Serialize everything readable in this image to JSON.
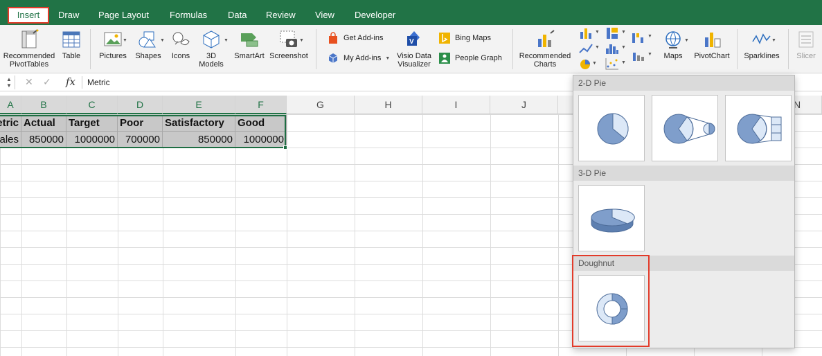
{
  "tabs": [
    {
      "label": "Insert",
      "active": true
    },
    {
      "label": "Draw"
    },
    {
      "label": "Page Layout"
    },
    {
      "label": "Formulas"
    },
    {
      "label": "Data"
    },
    {
      "label": "Review"
    },
    {
      "label": "View"
    },
    {
      "label": "Developer"
    }
  ],
  "ribbon": {
    "recommended_pivot": "Recommended PivotTables",
    "recommended_pivot_line1": "Recommended",
    "recommended_pivot_line2": "PivotTables",
    "table": "Table",
    "pictures": "Pictures",
    "shapes": "Shapes",
    "icons": "Icons",
    "models_3d_line1": "3D",
    "models_3d_line2": "Models",
    "smartart": "SmartArt",
    "screenshot": "Screenshot",
    "get_addins": "Get Add-ins",
    "my_addins": "My Add-ins",
    "visio_line1": "Visio Data",
    "visio_line2": "Visualizer",
    "bing_maps": "Bing Maps",
    "people_graph": "People Graph",
    "recommended_charts_line1": "Recommended",
    "recommended_charts_line2": "Charts",
    "maps": "Maps",
    "pivotchart": "PivotChart",
    "sparklines": "Sparklines",
    "slicer": "Slicer"
  },
  "formula_bar": {
    "content": "Metric"
  },
  "columns": [
    "A",
    "B",
    "C",
    "D",
    "E",
    "F",
    "G",
    "H",
    "I",
    "J",
    "N"
  ],
  "sheet": {
    "header_row": [
      "Metric",
      "Actual",
      "Target",
      "Poor",
      "Satisfactory",
      "Good"
    ],
    "data_row": [
      "Sales",
      "850000",
      "1000000",
      "700000",
      "850000",
      "1000000"
    ]
  },
  "dropdown": {
    "sections": [
      "2-D Pie",
      "3-D Pie",
      "Doughnut"
    ]
  },
  "colors": {
    "excel_green": "#217346",
    "highlight_red": "#e23b2a",
    "chart_blue": "#7f9ecb",
    "chart_light": "#dce8f7"
  }
}
